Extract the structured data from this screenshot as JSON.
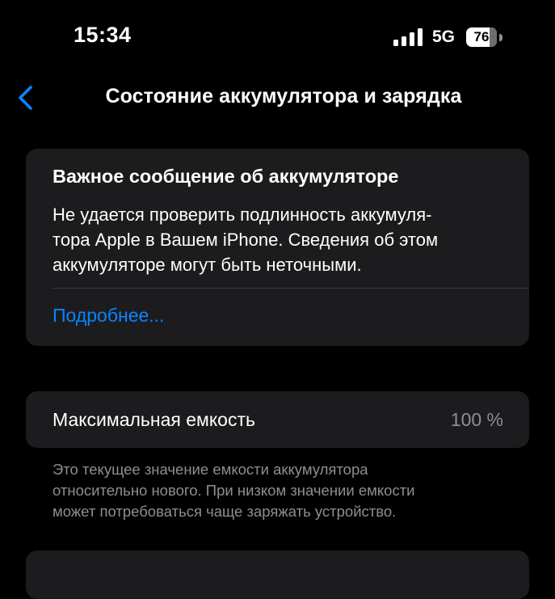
{
  "status_bar": {
    "time": "15:34",
    "network": "5G",
    "battery_percent": "76",
    "battery_level": 0.76,
    "signal_bars": 4,
    "icons": [
      "cellular-signal-icon",
      "battery-icon"
    ]
  },
  "nav": {
    "back_icon": "chevron-left-icon",
    "title": "Состояние аккумулятора и зарядка"
  },
  "alert_card": {
    "title": "Важное сообщение об аккумуляторе",
    "body_lines": [
      "Не удается проверить подлинность аккумуля-",
      "тора Apple в Вашем iPhone. Сведения об этом",
      "аккумуляторе могут быть неточными."
    ],
    "link": "Подробнее..."
  },
  "capacity": {
    "label": "Максимальная емкость",
    "value": "100 %"
  },
  "footnote": {
    "lines": [
      "Это текущее значение емкости аккумулятора",
      "относительно нового. При низком значении емкости",
      "может потребоваться чаще заряжать устройство."
    ]
  },
  "colors": {
    "background": "#000000",
    "card": "#1c1c1e",
    "accent": "#0a84ff",
    "secondary_text": "#8e8e93",
    "separator": "#38383a"
  }
}
